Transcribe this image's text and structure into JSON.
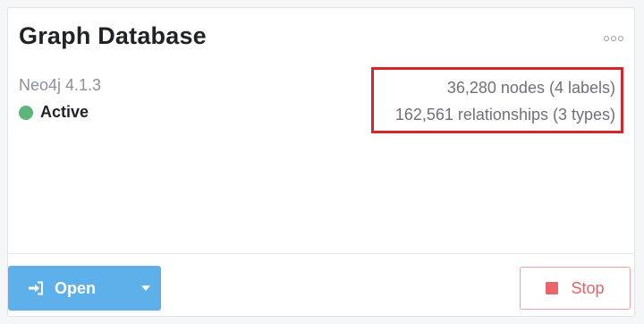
{
  "card": {
    "title": "Graph Database",
    "more_icon": "more-horizontal-icon",
    "version": "Neo4j 4.1.3",
    "status": {
      "label": "Active",
      "color": "#5db57a"
    },
    "stats": {
      "nodes": "36,280 nodes (4 labels)",
      "relationships": "162,561 relationships (3 types)",
      "highlight_color": "#d6262c"
    }
  },
  "actions": {
    "open": {
      "label": "Open",
      "icon": "sign-in-icon",
      "dropdown_icon": "caret-down-icon",
      "color": "#5db0ea"
    },
    "stop": {
      "label": "Stop",
      "icon": "stop-square-icon",
      "color": "#e06368"
    }
  }
}
